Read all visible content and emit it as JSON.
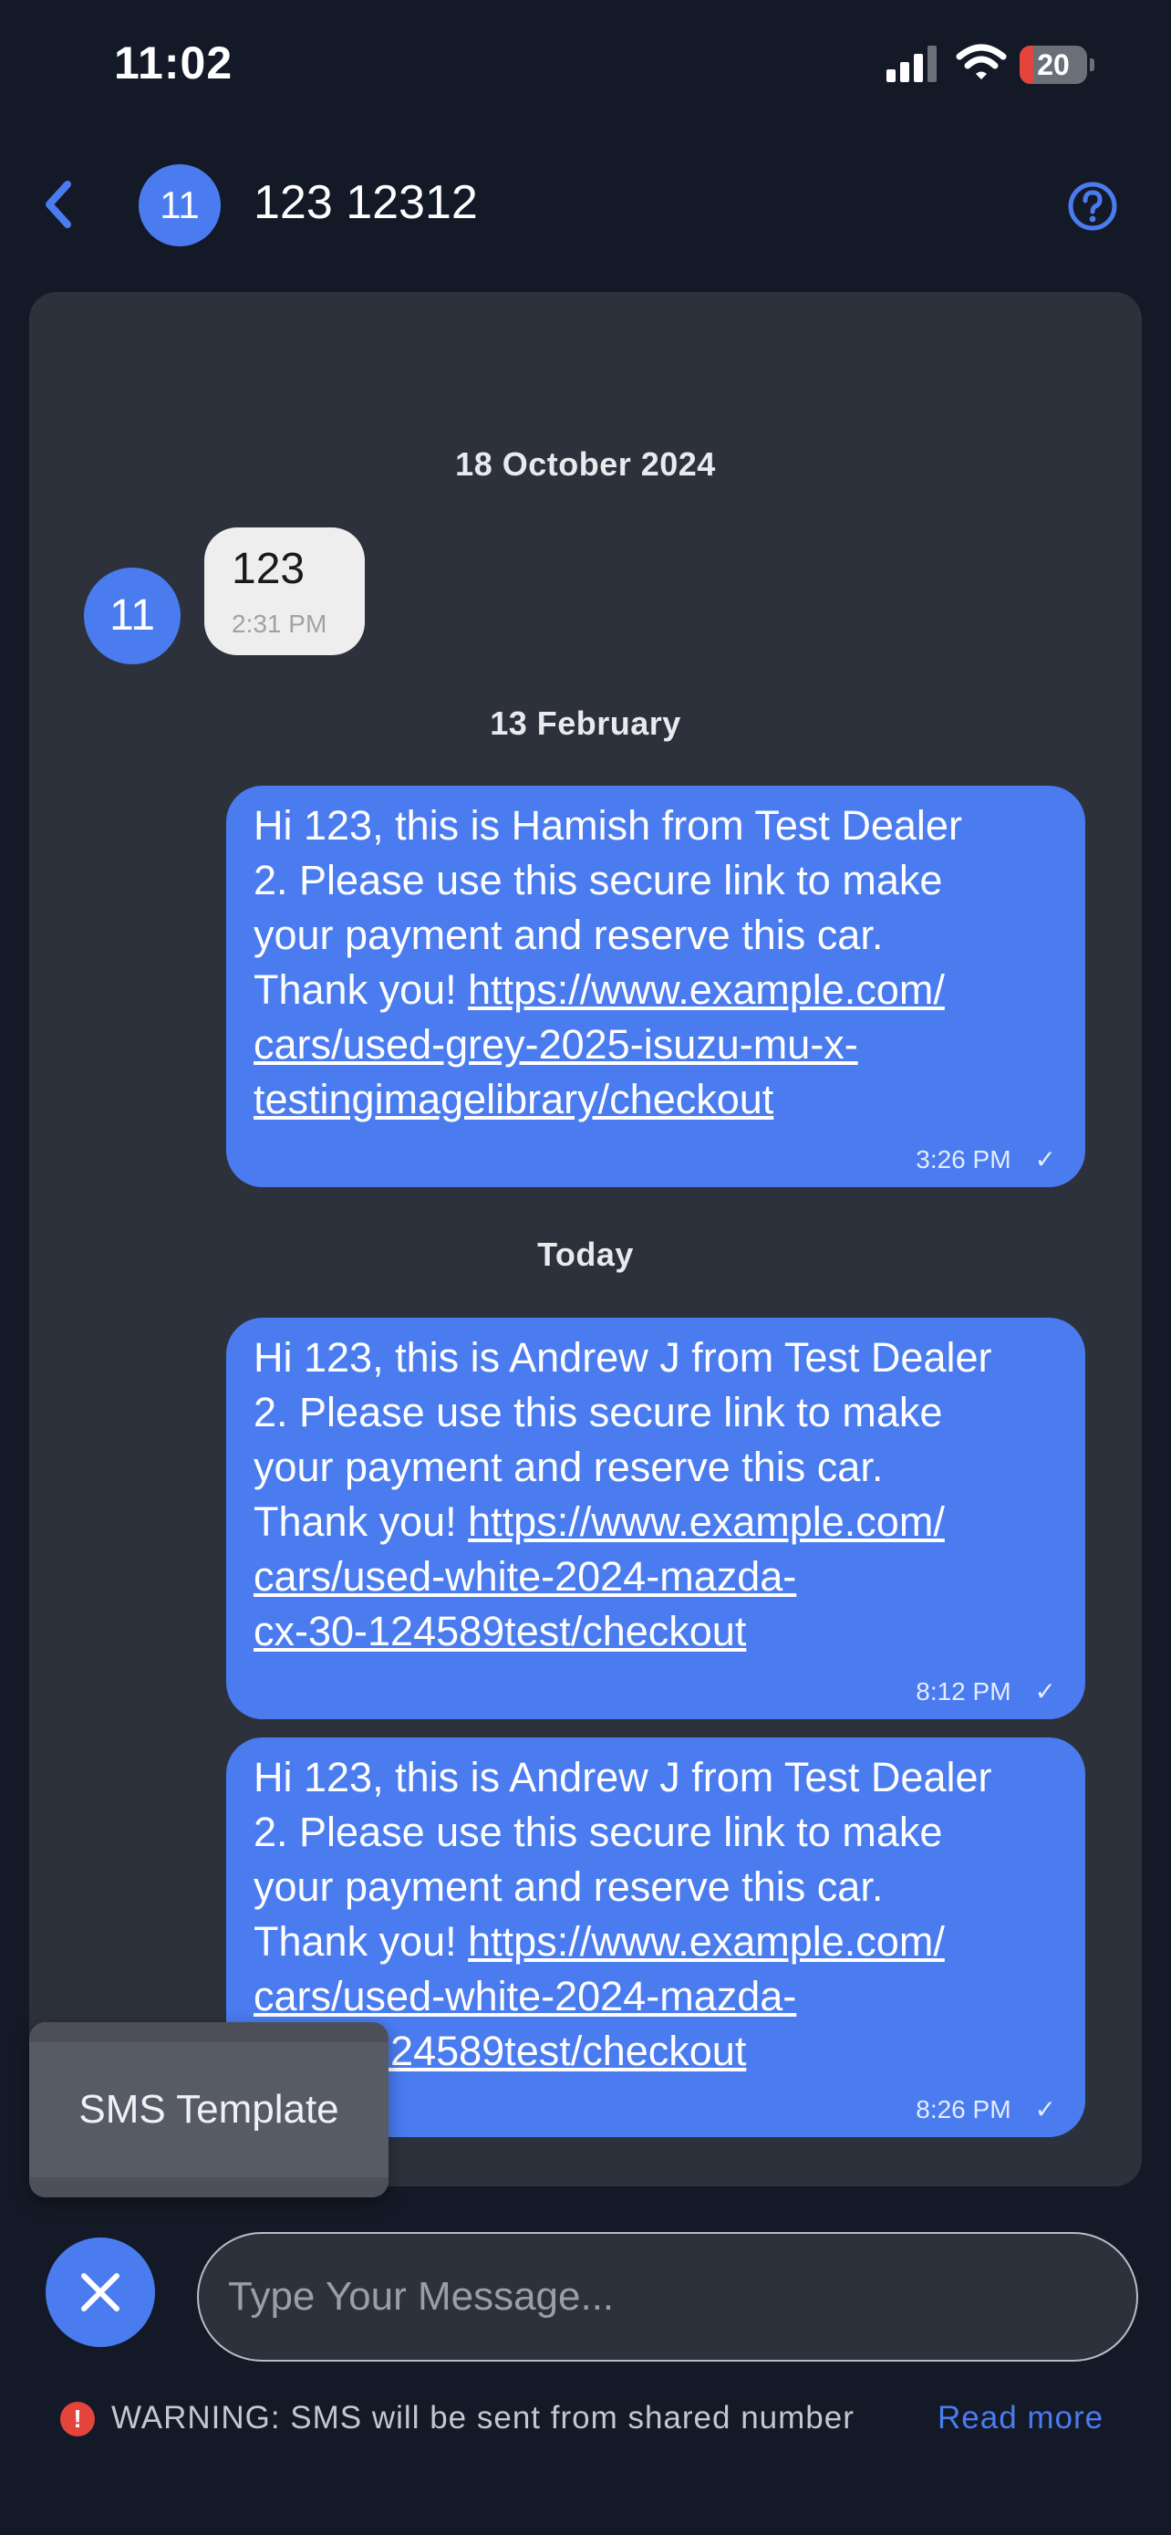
{
  "status_bar": {
    "time": "11:02",
    "battery_level": "20",
    "battery_fraction": 0.2,
    "battery_color": "#e5443b",
    "icons": [
      "signal-icon",
      "wifi-icon",
      "battery-icon"
    ]
  },
  "header": {
    "back_icon": "chevron-left-icon",
    "avatar_initials": "11",
    "contact_name": "123 12312",
    "help_icon": "question-circle-icon"
  },
  "conversation": {
    "dates": [
      "18 October 2024",
      "13 February",
      "Today"
    ],
    "incoming": {
      "avatar_initials": "11",
      "text": "123",
      "time": "2:31 PM"
    },
    "outgoing": [
      {
        "text": "Hi 123, this is Hamish from Test Dealer\n2. Please use this secure link to make\nyour payment and reserve this car.\nThank you! ",
        "link": "https://www.example.com/\ncars/used-grey-2025-isuzu-mu-x-\ntestingimagelibrary/checkout",
        "time": "3:26 PM",
        "status": "✓"
      },
      {
        "text": "Hi 123, this is Andrew J from Test Dealer\n2. Please use this secure link to make\nyour payment and reserve this car.\nThank you! ",
        "link": "https://www.example.com/\ncars/used-white-2024-mazda-\ncx-30-124589test/checkout",
        "time": "8:12 PM",
        "status": "✓"
      },
      {
        "text": "Hi 123, this is Andrew J from Test Dealer\n2. Please use this secure link to make\nyour payment and reserve this car.\nThank you! ",
        "link": "https://www.example.com/\ncars/used-white-2024-mazda-\ncx-30-124589test/checkout",
        "time": "8:26 PM",
        "status": "✓"
      }
    ]
  },
  "template_menu": {
    "items": [
      "SMS Template"
    ]
  },
  "composer": {
    "close_icon": "close-icon",
    "placeholder": "Type Your Message..."
  },
  "warning": {
    "icon": "exclamation-circle-icon",
    "text": "WARNING: SMS will be sent from shared number",
    "link_label": "Read more"
  },
  "colors": {
    "background": "#141927",
    "panel": "#2d313b",
    "accent": "#4a7cf0",
    "incoming_bubble": "#eeeeee",
    "warning": "#e5443b"
  }
}
